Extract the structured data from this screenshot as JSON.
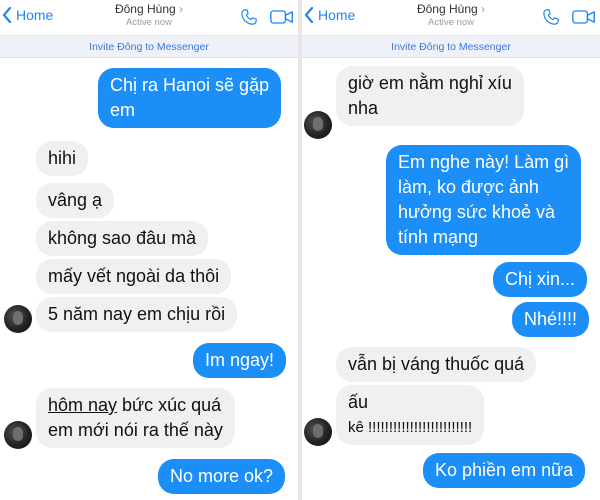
{
  "panes": [
    {
      "header": {
        "back_label": "Home",
        "contact_name": "Đông Hùng",
        "status": "Active now"
      },
      "invite_text": "Invite Đông to Messenger"
    },
    {
      "header": {
        "back_label": "Home",
        "contact_name": "Đông Hùng",
        "status": "Active now"
      },
      "invite_text": "Invite Đông to Messenger"
    }
  ],
  "left_messages": {
    "m0": [
      "Chị ra Hanoi sẽ gặp",
      "em"
    ],
    "m1": "hihi",
    "m2": "vâng ạ",
    "m3": "không sao đâu mà",
    "m4": "mấy vết ngoài da thôi",
    "m5": "5 năm nay em chịu rồi",
    "m6": "Im ngay!",
    "m7": {
      "underlined": "hôm nay",
      "rest": " bức xúc quá",
      "line2": "em mới nói ra thế này"
    },
    "m8": "No more ok?"
  },
  "right_messages": {
    "m0": [
      "giờ em nằm nghỉ xíu",
      "nha"
    ],
    "m1": [
      "Em nghe này! Làm gì",
      "làm, ko được ảnh",
      "hưởng sức khoẻ và",
      "tính mạng"
    ],
    "m2": "Chị xin...",
    "m3": "Nhé!!!!",
    "m4": "vẫn bị váng thuốc quá",
    "m5": [
      "ấu",
      "kê !!!!!!!!!!!!!!!!!!!!!!!!!"
    ],
    "m6": "Ko phiền em nữa"
  },
  "colors": {
    "accent": "#1e88f0",
    "outgoing_bubble": "#1b8ef7",
    "incoming_bubble": "#f0f0f0",
    "invite_bar": "#eef2f8"
  },
  "icons": [
    "chevron-left-icon",
    "phone-icon",
    "video-camera-icon"
  ]
}
